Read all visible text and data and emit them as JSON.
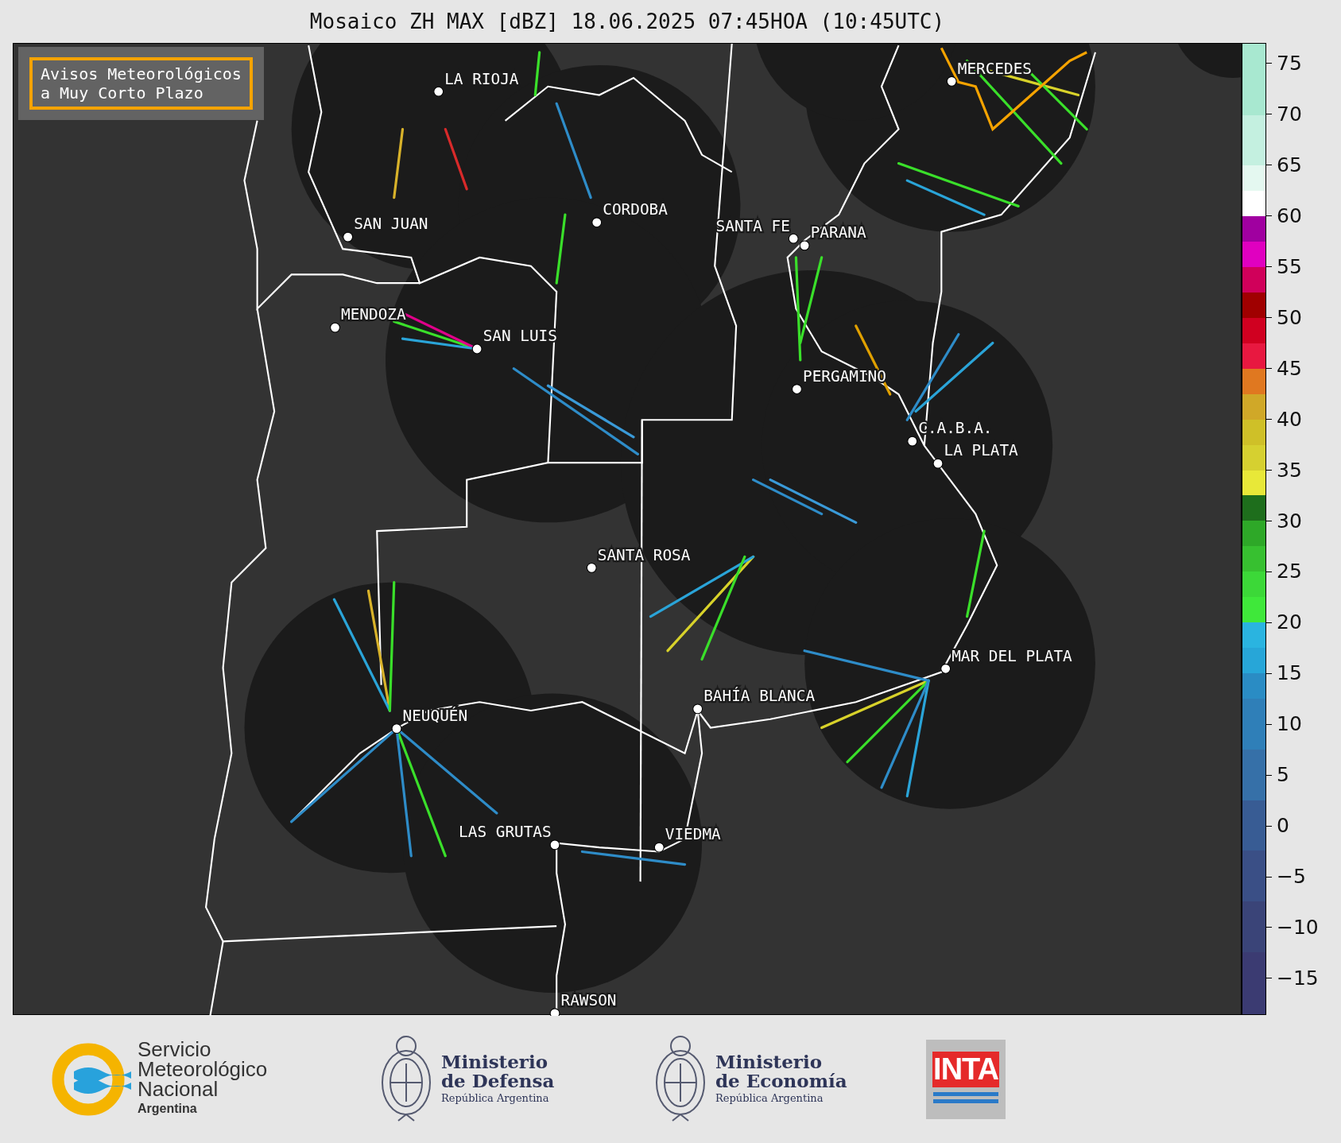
{
  "title": "Mosaico ZH MAX [dBZ] 18.06.2025 07:45HOA (10:45UTC)",
  "legend": {
    "lines": [
      "Avisos Meteorológicos",
      "a Muy Corto Plazo"
    ]
  },
  "cities": [
    {
      "name": "MERCEDES"
    },
    {
      "name": "LA RIOJA"
    },
    {
      "name": "CORDOBA"
    },
    {
      "name": "SAN JUAN"
    },
    {
      "name": "SANTA FE"
    },
    {
      "name": "PARANA"
    },
    {
      "name": "MENDOZA"
    },
    {
      "name": "SAN LUIS"
    },
    {
      "name": "PERGAMINO"
    },
    {
      "name": "C.A.B.A."
    },
    {
      "name": "LA PLATA"
    },
    {
      "name": "SANTA ROSA"
    },
    {
      "name": "MAR DEL PLATA"
    },
    {
      "name": "BAHÍA BLANCA"
    },
    {
      "name": "NEUQUÉN"
    },
    {
      "name": "LAS GRUTAS"
    },
    {
      "name": "VIEDMA"
    },
    {
      "name": "RAWSON"
    }
  ],
  "colorbar": {
    "ticks": [
      "75",
      "70",
      "65",
      "60",
      "55",
      "50",
      "45",
      "40",
      "35",
      "30",
      "25",
      "20",
      "15",
      "10",
      "5",
      "0",
      "−5",
      "−10",
      "−15"
    ]
  },
  "footer": {
    "smn": {
      "lines": [
        "Servicio",
        "Meteorológico",
        "Nacional"
      ],
      "country": "Argentina"
    },
    "ministries": [
      {
        "line1": "Ministerio",
        "line2": "de Defensa",
        "country": "República Argentina"
      },
      {
        "line1": "Ministerio",
        "line2": "de Economía",
        "country": "República Argentina"
      }
    ],
    "inta": "INTA"
  }
}
